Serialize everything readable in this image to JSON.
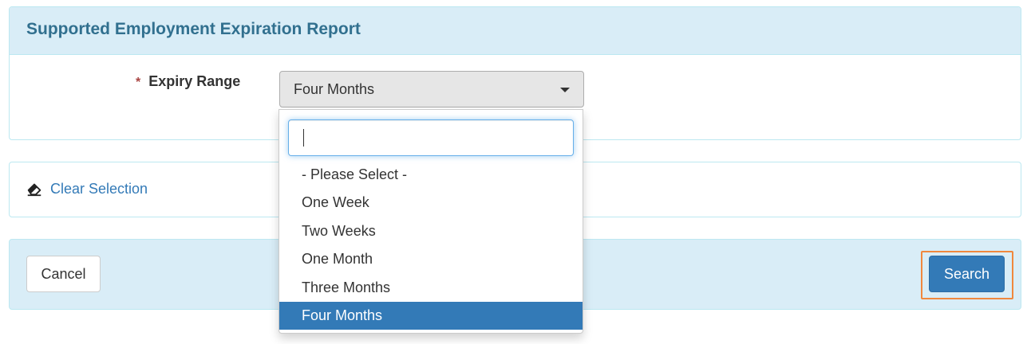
{
  "report": {
    "title": "Supported Employment Expiration Report",
    "required_mark": "*",
    "field_label": "Expiry Range",
    "selected_value": "Four Months"
  },
  "dropdown": {
    "search_value": "",
    "options": [
      {
        "label": "- Please Select -",
        "selected": false
      },
      {
        "label": "One Week",
        "selected": false
      },
      {
        "label": "Two Weeks",
        "selected": false
      },
      {
        "label": "One Month",
        "selected": false
      },
      {
        "label": "Three Months",
        "selected": false
      },
      {
        "label": "Four Months",
        "selected": true
      }
    ]
  },
  "clear": {
    "label": "Clear Selection",
    "icon": "eraser-icon"
  },
  "actions": {
    "cancel_label": "Cancel",
    "search_label": "Search"
  },
  "colors": {
    "heading_bg": "#d9edf7",
    "heading_text": "#31708f",
    "link": "#337ab7",
    "primary": "#337ab7",
    "focus_outline": "#f0883e",
    "required": "#a94442"
  }
}
